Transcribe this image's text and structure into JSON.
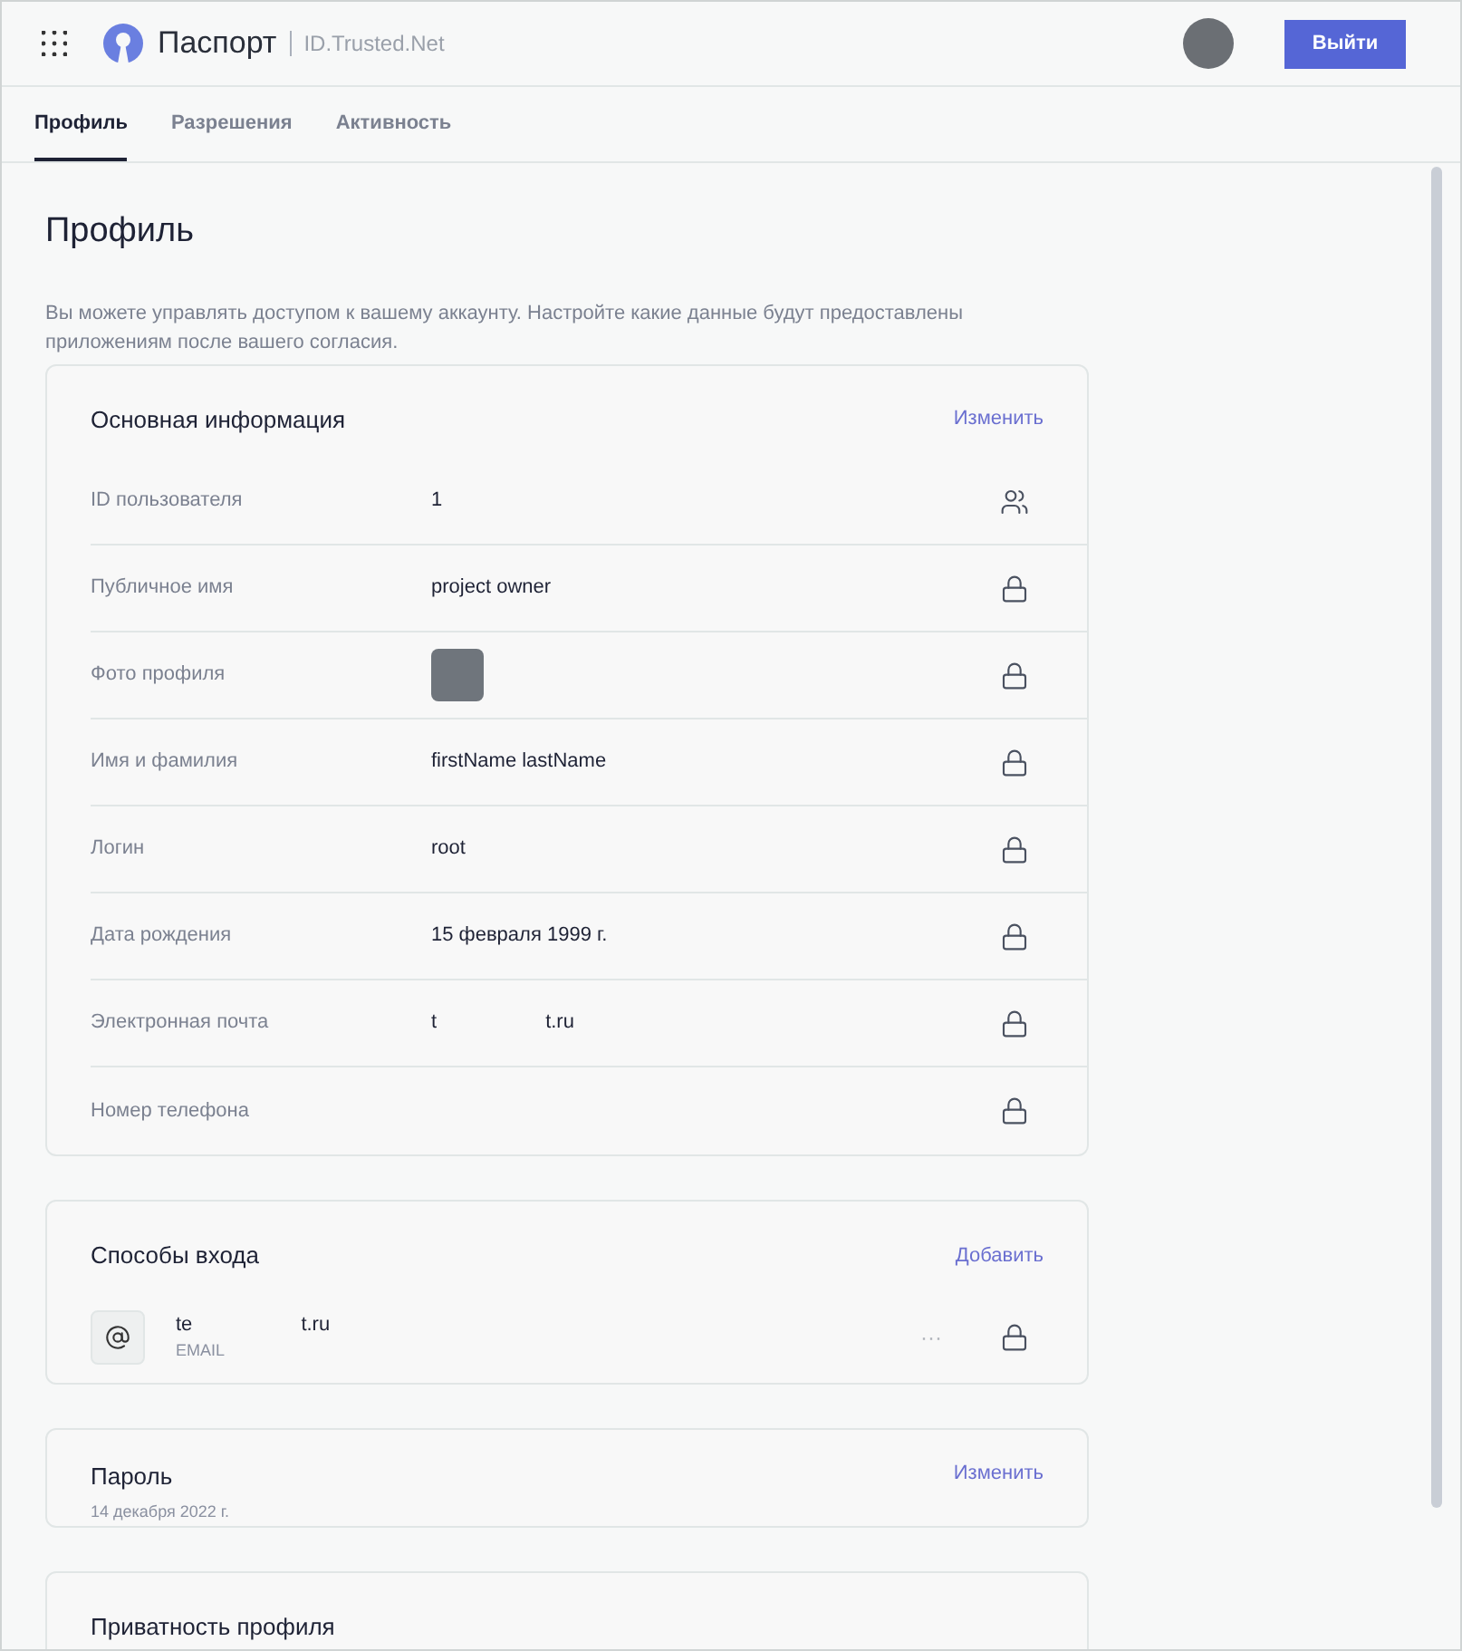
{
  "header": {
    "title": "Паспорт",
    "subtitle": "ID.Trusted.Net",
    "logout_button": "Выйти"
  },
  "tabs": [
    {
      "label": "Профиль",
      "selected": true
    },
    {
      "label": "Разрешения",
      "selected": false
    },
    {
      "label": "Активность",
      "selected": false
    }
  ],
  "page": {
    "title": "Профиль",
    "description": "Вы можете управлять доступом к вашему аккаунту. Настройте какие данные будут предоставлены приложениям после вашего согласия."
  },
  "basic_info": {
    "title": "Основная информация",
    "action": "Изменить",
    "rows": [
      {
        "label": "ID пользователя",
        "kind": "text",
        "value": "1",
        "locked": false
      },
      {
        "label": "Публичное имя",
        "kind": "text",
        "value": "project owner",
        "locked": true
      },
      {
        "label": "Фото профиля",
        "kind": "photo",
        "locked": true
      },
      {
        "label": "Имя и фамилия",
        "kind": "text",
        "value": "firstName lastName",
        "locked": true
      },
      {
        "label": "Логин",
        "kind": "text",
        "value": "root",
        "locked": true
      },
      {
        "label": "Дата рождения",
        "kind": "text",
        "value": "15 февраля 1999 г.",
        "locked": true
      },
      {
        "label": "Электронная почта",
        "kind": "split",
        "parts": [
          "t",
          "t.ru"
        ],
        "locked": true
      },
      {
        "label": "Номер телефона",
        "kind": "empty",
        "locked": true
      }
    ]
  },
  "login_methods": {
    "title": "Способы входа",
    "action": "Добавить",
    "items": [
      {
        "parts": [
          "te",
          "t.ru"
        ],
        "type": "EMAIL",
        "menu": "···",
        "locked": true
      }
    ]
  },
  "password": {
    "title": "Пароль",
    "date": "14 декабря 2022 г.",
    "action": "Изменить"
  },
  "privacy": {
    "title": "Приватность профиля"
  }
}
